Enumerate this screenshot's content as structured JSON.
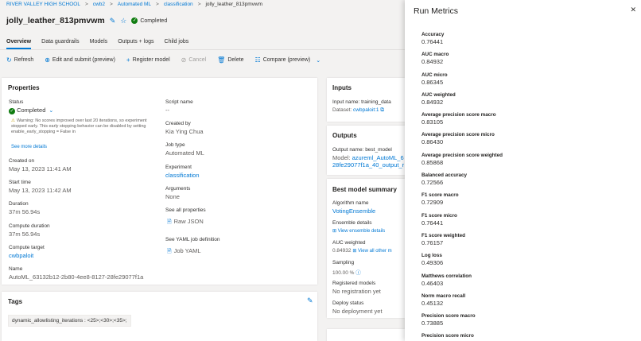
{
  "breadcrumb": {
    "items": [
      "RIVER VALLEY HIGH SCHOOL",
      "cwb2",
      "Automated ML",
      "classification"
    ],
    "current": "jolly_leather_813pmvwm"
  },
  "header": {
    "title": "jolly_leather_813pmvwm",
    "status": "Completed"
  },
  "tabs": [
    "Overview",
    "Data guardrails",
    "Models",
    "Outputs + logs",
    "Child jobs"
  ],
  "toolbar": {
    "refresh": "Refresh",
    "edit_submit": "Edit and submit (preview)",
    "register_model": "Register model",
    "cancel": "Cancel",
    "delete": "Delete",
    "compare": "Compare (preview)"
  },
  "properties": {
    "title": "Properties",
    "status_label": "Status",
    "status_value": "Completed",
    "warning": "Warning: No scores improved over last 20 iterations, so experiment stopped early. This early stopping behavior can be disabled by setting enable_early_stopping = False in",
    "see_more": "See more details",
    "created_on_label": "Created on",
    "created_on": "May 13, 2023 11:41 AM",
    "start_time_label": "Start time",
    "start_time": "May 13, 2023 11:42 AM",
    "duration_label": "Duration",
    "duration": "37m 56.94s",
    "compute_duration_label": "Compute duration",
    "compute_duration": "37m 56.94s",
    "compute_target_label": "Compute target",
    "compute_target": "cwbpaloit",
    "name_label": "Name",
    "name": "AutoML_63132b12-2b80-4ee8-8127-28fe29077f1a",
    "script_name_label": "Script name",
    "script_name": "--",
    "created_by_label": "Created by",
    "created_by": "Kia Ying Chua",
    "job_type_label": "Job type",
    "job_type": "Automated ML",
    "experiment_label": "Experiment",
    "experiment": "classification",
    "arguments_label": "Arguments",
    "arguments": "None",
    "see_all_props_label": "See all properties",
    "raw_json": "Raw JSON",
    "see_yaml_label": "See YAML job definition",
    "job_yaml": "Job YAML"
  },
  "inputs": {
    "title": "Inputs",
    "input_name": "Input name: training_data",
    "dataset_label": "Dataset:",
    "dataset": "cwbpaloit:1"
  },
  "outputs": {
    "title": "Outputs",
    "output_name": "Output name: best_model",
    "model_label": "Model:",
    "model_line1": "azureml_AutoML_6",
    "model_line2": "28fe29077f1a_40_output_r"
  },
  "best_model": {
    "title": "Best model summary",
    "algorithm_label": "Algorithm name",
    "algorithm": "VotingEnsemble",
    "ensemble_label": "Ensemble details",
    "ensemble_link": "View ensemble details",
    "auc_label": "AUC weighted",
    "auc_value": "0.84932",
    "auc_link": "View all other m",
    "sampling_label": "Sampling",
    "sampling_value": "100.00 %",
    "registered_label": "Registered models",
    "registered_value": "No registration yet",
    "deploy_label": "Deploy status",
    "deploy_value": "No deployment yet"
  },
  "tags": {
    "title": "Tags",
    "chip": "dynamic_allowlisting_iterations : <25>;<30>;<35>;"
  },
  "panel": {
    "title": "Run Metrics",
    "metrics": [
      {
        "name": "Accuracy",
        "value": "0.76441"
      },
      {
        "name": "AUC macro",
        "value": "0.84932"
      },
      {
        "name": "AUC micro",
        "value": "0.86345"
      },
      {
        "name": "AUC weighted",
        "value": "0.84932"
      },
      {
        "name": "Average precision score macro",
        "value": "0.83105"
      },
      {
        "name": "Average precision score micro",
        "value": "0.86430"
      },
      {
        "name": "Average precision score weighted",
        "value": "0.85868"
      },
      {
        "name": "Balanced accuracy",
        "value": "0.72566"
      },
      {
        "name": "F1 score macro",
        "value": "0.72909"
      },
      {
        "name": "F1 score micro",
        "value": "0.76441"
      },
      {
        "name": "F1 score weighted",
        "value": "0.76157"
      },
      {
        "name": "Log loss",
        "value": "0.49306"
      },
      {
        "name": "Matthews correlation",
        "value": "0.46403"
      },
      {
        "name": "Norm macro recall",
        "value": "0.45132"
      },
      {
        "name": "Precision score macro",
        "value": "0.73885"
      },
      {
        "name": "Precision score micro",
        "value": ""
      }
    ]
  }
}
